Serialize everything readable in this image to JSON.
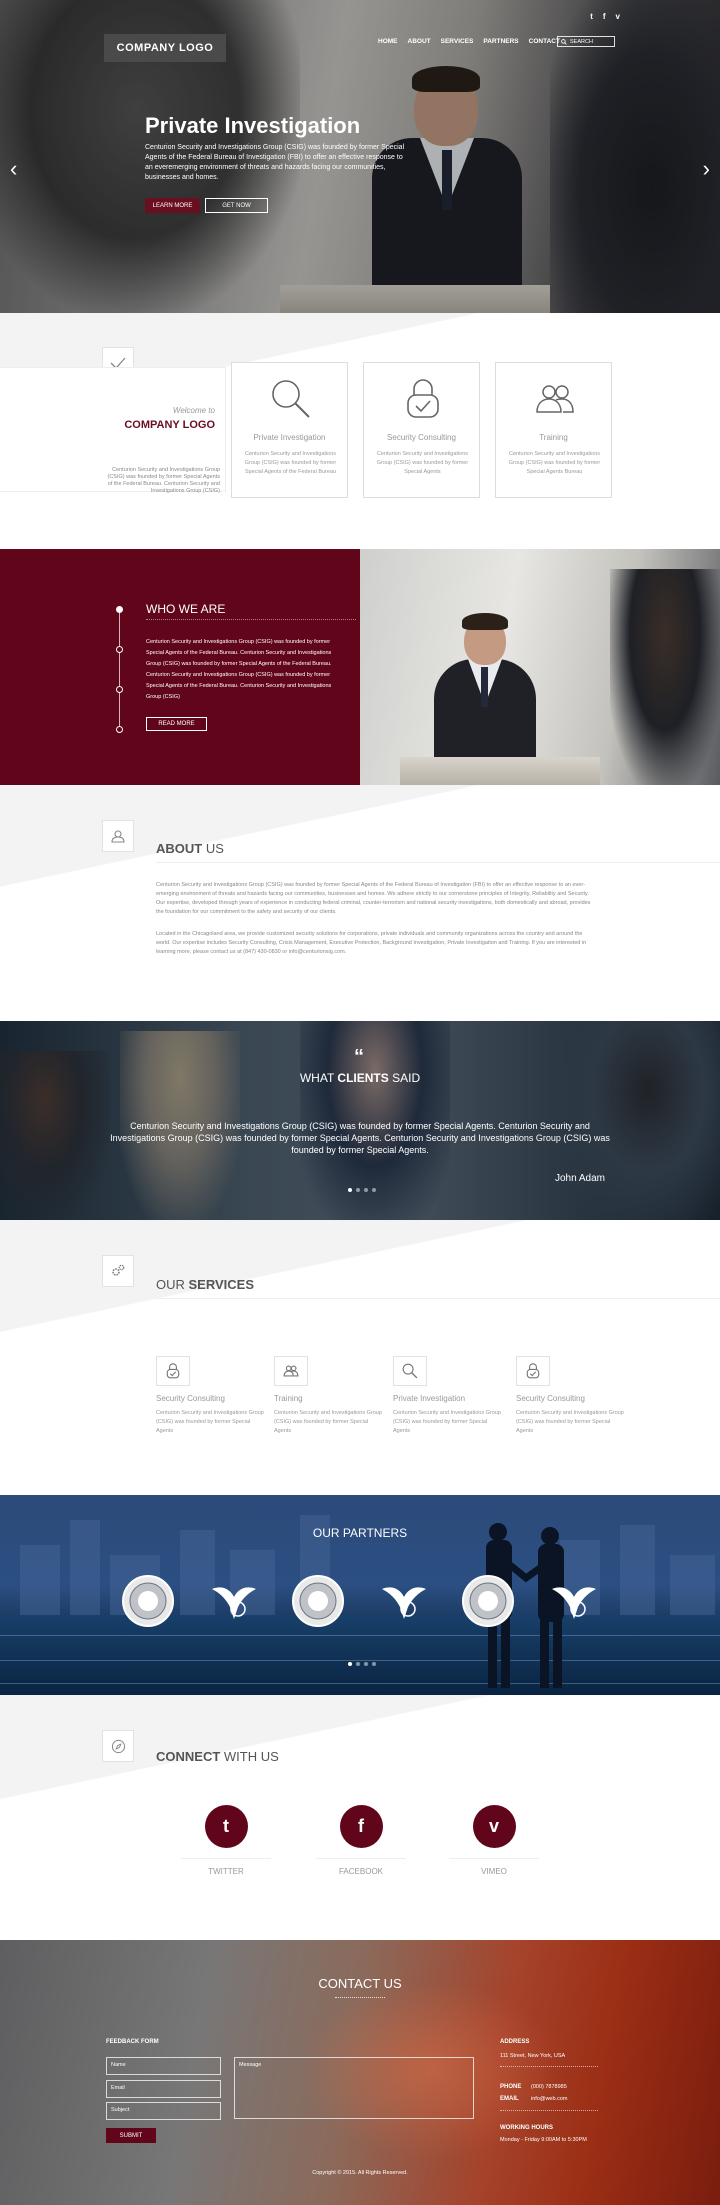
{
  "header": {
    "logo": "COMPANY LOGO",
    "social": [
      "t",
      "f",
      "v"
    ],
    "nav": [
      "HOME",
      "ABOUT",
      "SERVICES",
      "PARTNERS",
      "CONTACT"
    ],
    "search_placeholder": "SEARCH"
  },
  "hero": {
    "title": "Private Investigation",
    "description": "Centurion Security and Investigations Group (CSIG) was founded by former Special Agents of the Federal Bureau of Investigation (FBI) to offer an effective response to an everemerging environment of threats and hazards facing our communities, businesses and homes.",
    "learn_more": "LEARN MORE",
    "get_now": "GET NOW"
  },
  "welcome": {
    "small": "Welcome to",
    "title": "COMPANY LOGO",
    "text": "Centurion Security and Investigations Group (CSIG) was founded by former Special Agents of the Federal Bureau. Centurion Security and Investigations Group (CSIG)",
    "cards": [
      {
        "title": "Private Investigation",
        "text": "Centurion Security and Investigations Group (CSIG) was founded by former Special Agents of the Federal Bureau"
      },
      {
        "title": "Security Consulting",
        "text": "Centurion Security and Investigations Group (CSIG) was founded by former Special Agents"
      },
      {
        "title": "Training",
        "text": "Centurion Security and Investigations Group (CSIG) was founded by former Special Agents Bureau"
      }
    ]
  },
  "who": {
    "title": "WHO WE ARE",
    "text": "Centurion Security and Investigations Group (CSIG) was founded by former Special Agents of the Federal Bureau. Centurion Security and Investigations Group (CSIG) was founded by former Special Agents of the Federal Bureau. Centurion Security and Investigations Group (CSIG) was founded by former Special Agents of the Federal Bureau. Centurion Security and Investigations Group (CSIG)",
    "button": "READ MORE"
  },
  "about": {
    "title_a": "ABOUT",
    "title_b": "US",
    "para1": "Centurion Security and Investigations Group (CSIG) was founded by former Special Agents of the Federal Bureau of Investigation (FBI) to offer an effective response to an ever-emerging environment of threats and hazards facing our communities, businesses and homes. We adhere strictly to our cornerstone principles of Integrity, Reliability and Security. Our expertise, developed through years of experience in conducting federal criminal, counter-terrorism and national security investigations, both domestically and abroad, provides the foundation for our commitment to the safety and security of our clients.",
    "para2": "Located in the Chicagoland area, we provide customized security solutions for corporations, private individuals and community organizations across the country and around the world. Our expertise includes Security Consulting, Crisis Management, Executive Protection, Background Investigation, Private Investigation and Training. If you are interested in learning more, please contact us at (847) 430-0830 or info@centurionsig.com."
  },
  "testimonials": {
    "quote_mark": "“",
    "title_a": "WHAT",
    "title_b": "CLIENTS",
    "title_c": "SAID",
    "text": "Centurion Security and Investigations Group (CSIG) was founded by former Special Agents. Centurion Security and Investigations Group (CSIG) was founded by former Special Agents. Centurion Security and Investigations Group (CSIG) was founded by former Special Agents.",
    "author": "John Adam"
  },
  "services": {
    "title_a": "OUR",
    "title_b": "SERVICES",
    "items": [
      {
        "title": "Security Consulting",
        "text": "Centurion Security and Investigations Group (CSIG) was founded by former Special Agents"
      },
      {
        "title": "Training",
        "text": "Centurion Security and Investigations Group (CSIG) was founded by former Special Agents"
      },
      {
        "title": "Private Investigation",
        "text": "Centurion Security and Investigations Group (CSIG) was founded by former Special Agents"
      },
      {
        "title": "Security Consulting",
        "text": "Centurion Security and Investigations Group (CSIG) was founded by former Special Agents"
      }
    ]
  },
  "partners": {
    "title": "OUR PARTNERS",
    "seal_text": "CSIG",
    "eagle_text": "CSIG"
  },
  "connect": {
    "title_a": "CONNECT",
    "title_b": "WITH US",
    "items": [
      {
        "label": "TWITTER",
        "glyph": "t",
        "icon": "twitter-icon"
      },
      {
        "label": "FACEBOOK",
        "glyph": "f",
        "icon": "facebook-icon"
      },
      {
        "label": "VIMEO",
        "glyph": "v",
        "icon": "vimeo-icon"
      }
    ]
  },
  "contact": {
    "title_a": "CONTACT",
    "title_b": "US",
    "form_title": "FEEDBACK FORM",
    "name_placeholder": "Name",
    "email_placeholder": "Email",
    "subject_placeholder": "Subject",
    "message_placeholder": "Message",
    "submit": "SUBMIT",
    "address_label": "ADDRESS",
    "address": "111 Street, New York, USA",
    "phone_label": "PHONE",
    "phone": "(000) 7878985",
    "email_label": "EMAIL",
    "email": "info@web.com",
    "hours_label": "WORKING HOURS",
    "hours": "Monday - Friday 9:00AM to 5:30PM",
    "copyright": "Copyright © 2015. All Rights Reserved."
  },
  "colors": {
    "brand": "#61061a",
    "accent": "#6a0e22"
  }
}
